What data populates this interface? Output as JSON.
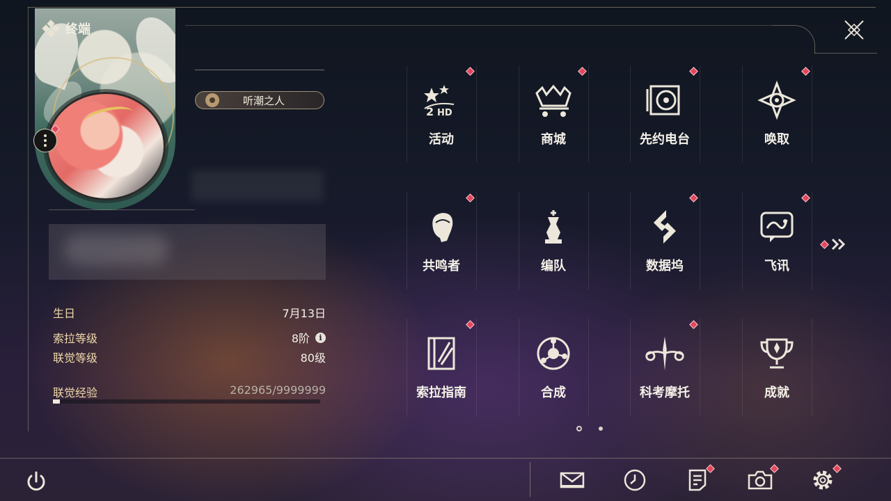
{
  "header": {
    "title": "终端"
  },
  "profile": {
    "title_badge": "听潮之人",
    "stats": [
      {
        "label": "生日",
        "value": "7月13日"
      },
      {
        "label": "索拉等级",
        "value": "8阶"
      },
      {
        "label": "联觉等级",
        "value": "80级"
      }
    ],
    "exp": {
      "label": "联觉经验",
      "value": "262965/9999999",
      "progress": 0.026
    }
  },
  "grid": {
    "items": [
      {
        "label": "活动",
        "icon": "event-2hd-icon",
        "badge": true
      },
      {
        "label": "商城",
        "icon": "shop-cart-icon",
        "badge": true
      },
      {
        "label": "先约电台",
        "icon": "radio-icon",
        "badge": true
      },
      {
        "label": "唤取",
        "icon": "convene-icon",
        "badge": true
      },
      {
        "label": "共鸣者",
        "icon": "resonator-icon",
        "badge": true
      },
      {
        "label": "编队",
        "icon": "team-chess-icon",
        "badge": false
      },
      {
        "label": "数据坞",
        "icon": "data-bank-icon",
        "badge": true
      },
      {
        "label": "飞讯",
        "icon": "message-icon",
        "badge": true
      },
      {
        "label": "索拉指南",
        "icon": "guidebook-icon",
        "badge": true
      },
      {
        "label": "合成",
        "icon": "synthesis-icon",
        "badge": false
      },
      {
        "label": "科考摩托",
        "icon": "motorbike-icon",
        "badge": true
      },
      {
        "label": "成就",
        "icon": "trophy-icon",
        "badge": false
      }
    ],
    "pages": 2,
    "current_page": 1
  },
  "bottom_bar": {
    "buttons": [
      {
        "icon": "mail-icon",
        "badge": false
      },
      {
        "icon": "clock-icon",
        "badge": false
      },
      {
        "icon": "notes-icon",
        "badge": true
      },
      {
        "icon": "camera-icon",
        "badge": true
      },
      {
        "icon": "gear-icon",
        "badge": true
      }
    ]
  },
  "colors": {
    "accent_red": "#e3475d",
    "label_gold": "#f0d9a9",
    "text": "#f4f1e8"
  }
}
